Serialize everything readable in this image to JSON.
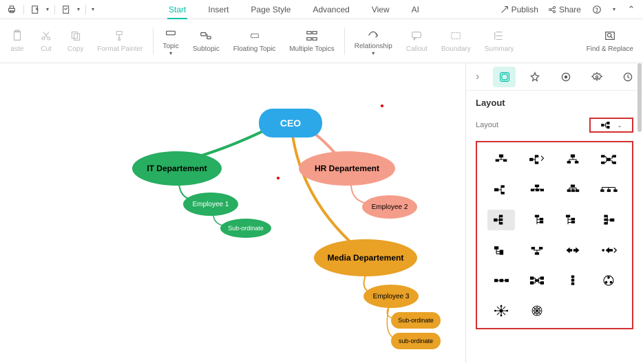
{
  "menu_tabs": [
    "Start",
    "Insert",
    "Page Style",
    "Advanced",
    "View",
    "AI"
  ],
  "active_tab": "Start",
  "titlebar_right": {
    "publish": "Publish",
    "share": "Share"
  },
  "ribbon": {
    "paste": "aste",
    "cut": "Cut",
    "copy": "Copy",
    "format_painter": "Format Painter",
    "topic": "Topic",
    "subtopic": "Subtopic",
    "floating_topic": "Floating Topic",
    "multiple_topics": "Multiple Topics",
    "relationship": "Relationship",
    "callout": "Callout",
    "boundary": "Boundary",
    "summary": "Summary",
    "find_replace": "Find & Replace"
  },
  "mindmap": {
    "ceo": "CEO",
    "it": "IT Departement",
    "hr": "HR Departement",
    "media": "Media Departement",
    "emp1": "Employee 1",
    "emp2": "Employee 2",
    "emp3": "Employee 3",
    "sub1": "Sub-ordinate",
    "sub2": "Sub-ordinate",
    "sub3": "sub-ordinate"
  },
  "panel": {
    "title": "Layout",
    "layout_label": "Layout"
  }
}
